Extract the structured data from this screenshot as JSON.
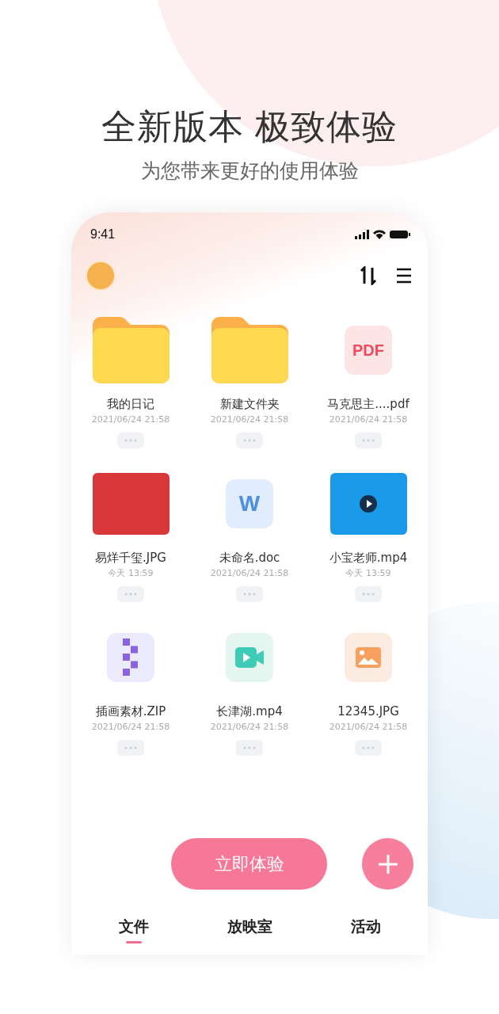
{
  "headline": "全新版本 极致体验",
  "subtitle": "为您带来更好的使用体验",
  "status_bar": {
    "time": "9:41"
  },
  "files": [
    {
      "kind": "folder",
      "name": "我的日记",
      "time": "2021/06/24 21:58"
    },
    {
      "kind": "folder",
      "name": "新建文件夹",
      "time": "2021/06/24 21:58"
    },
    {
      "kind": "pdf",
      "name": "马克思主....pdf",
      "time": "2021/06/24 21:58",
      "badge": "PDF"
    },
    {
      "kind": "photo",
      "name": "易烊千玺.JPG",
      "time": "今天 13:59"
    },
    {
      "kind": "doc",
      "name": "未命名.doc",
      "time": "2021/06/24 21:58",
      "badge": "W"
    },
    {
      "kind": "video-thumb",
      "name": "小宝老师.mp4",
      "time": "今天 13:59"
    },
    {
      "kind": "zip",
      "name": "插画素材.ZIP",
      "time": "2021/06/24 21:58"
    },
    {
      "kind": "video",
      "name": "长津湖.mp4",
      "time": "2021/06/24 21:58"
    },
    {
      "kind": "image",
      "name": "12345.JPG",
      "time": "2021/06/24 21:58"
    }
  ],
  "cta": "立即体验",
  "tabs": [
    {
      "label": "文件",
      "selected": true
    },
    {
      "label": "放映室",
      "selected": false
    },
    {
      "label": "活动",
      "selected": false
    }
  ]
}
